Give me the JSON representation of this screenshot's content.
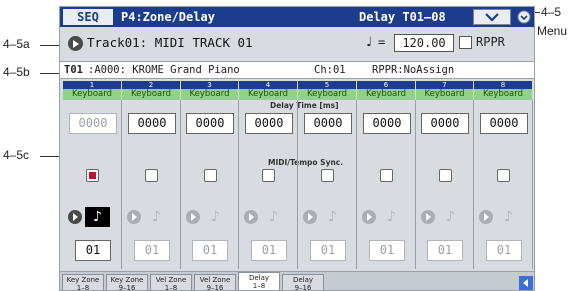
{
  "callouts": {
    "menu": "4–5",
    "menu_word": "Menu",
    "a": "4–5a",
    "b": "4–5b",
    "c": "4–5c"
  },
  "header": {
    "mode": "SEQ",
    "page": "P4:Zone/Delay",
    "title": "Delay T01–08"
  },
  "track": {
    "name": "Track01: MIDI TRACK 01",
    "tempo_symbol": "♩",
    "tempo_eq": "=",
    "tempo": "120.00",
    "rppr_label": "RPPR",
    "rppr_checked": false
  },
  "info": {
    "track": "T01",
    "program": ":A000: KROME Grand Piano",
    "channel": "Ch:01",
    "rppr": "RPPR:NoAssign"
  },
  "columns": [
    {
      "num": "1",
      "category": "Keyboard",
      "delay": "0000",
      "delay_enabled": false,
      "sync": true,
      "base_note": "♪",
      "times": "01",
      "active": true
    },
    {
      "num": "2",
      "category": "Keyboard",
      "delay": "0000",
      "delay_enabled": true,
      "sync": false,
      "base_note": "♪",
      "times": "01",
      "active": false
    },
    {
      "num": "3",
      "category": "Keyboard",
      "delay": "0000",
      "delay_enabled": true,
      "sync": false,
      "base_note": "♪",
      "times": "01",
      "active": false
    },
    {
      "num": "4",
      "category": "Keyboard",
      "delay": "0000",
      "delay_enabled": true,
      "sync": false,
      "base_note": "♪",
      "times": "01",
      "active": false
    },
    {
      "num": "5",
      "category": "Keyboard",
      "delay": "0000",
      "delay_enabled": true,
      "sync": false,
      "base_note": "♪",
      "times": "01",
      "active": false
    },
    {
      "num": "6",
      "category": "Keyboard",
      "delay": "0000",
      "delay_enabled": true,
      "sync": false,
      "base_note": "♪",
      "times": "01",
      "active": false
    },
    {
      "num": "7",
      "category": "Keyboard",
      "delay": "0000",
      "delay_enabled": true,
      "sync": false,
      "base_note": "♪",
      "times": "01",
      "active": false
    },
    {
      "num": "8",
      "category": "Keyboard",
      "delay": "0000",
      "delay_enabled": true,
      "sync": false,
      "base_note": "♪",
      "times": "01",
      "active": false
    }
  ],
  "sections": {
    "delay_time": "Delay Time [ms]",
    "sync": "MIDI/Tempo Sync."
  },
  "tabs": [
    {
      "line1": "Key Zone",
      "line2": "1–8",
      "active": false
    },
    {
      "line1": "Key Zone",
      "line2": "9–16",
      "active": false
    },
    {
      "line1": "Vel Zone",
      "line2": "1–8",
      "active": false
    },
    {
      "line1": "Vel Zone",
      "line2": "9–16",
      "active": false
    },
    {
      "line1": "Delay",
      "line2": "1–8",
      "active": true
    },
    {
      "line1": "Delay",
      "line2": "9–16",
      "active": false
    }
  ],
  "colors": {
    "header_blue": "#1c3d8e",
    "category_green": "#8fd08f",
    "sync_red": "#c8102e",
    "screen_bg": "#d8dbe0"
  }
}
